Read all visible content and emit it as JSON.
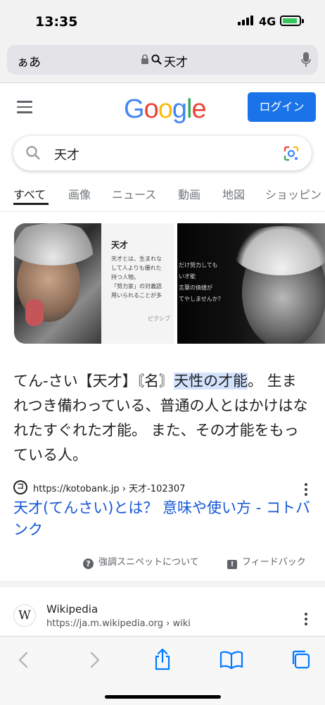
{
  "status_bar": {
    "time": "13:35",
    "network": "4G"
  },
  "browser": {
    "text_size_label": "ぁあ",
    "url": "天才"
  },
  "google": {
    "logo_letters": [
      {
        "ch": "G",
        "color": "#4285F4"
      },
      {
        "ch": "o",
        "color": "#EA4335"
      },
      {
        "ch": "o",
        "color": "#FBBC05"
      },
      {
        "ch": "g",
        "color": "#4285F4"
      },
      {
        "ch": "l",
        "color": "#34A853"
      },
      {
        "ch": "e",
        "color": "#EA4335"
      }
    ],
    "login_label": "ログイン",
    "query": "天才"
  },
  "tabs": [
    "すべて",
    "画像",
    "ニュース",
    "動画",
    "地図",
    "ショッピン"
  ],
  "images": {
    "card_title": "天才",
    "card_body": "天才とは、生まれな\nして人よりも優れた\n持つ人物。\n「努力家」の対義語\n用いられることが多",
    "card_credit": "ピクシブ",
    "quote_text": "だけ努力しても\nい才能\n言葉の価値が\nてやしませんか？"
  },
  "snippet": {
    "part1": "てん-さい【天才】〘名〙",
    "highlight": "天性の才能",
    "part2": "。 生まれつき備わっている、普通の人とはかけはなれたすぐれた才能。 また、その才能をもっている人。",
    "source_icon": "コ",
    "source_url": "https://kotobank.jp › 天才-102307",
    "title": "天才(てんさい)とは？ 意味や使い方 - コトバンク",
    "about_label": "強調スニペットについて",
    "feedback_label": "フィードバック"
  },
  "wiki": {
    "icon": "W",
    "name": "Wikipedia",
    "url": "https://ja.m.wikipedia.org › wiki"
  },
  "colors": {
    "accent": "#1a73e8",
    "link": "#1558d6",
    "highlight": "#d3e3fd",
    "ios_blue": "#007aff"
  }
}
